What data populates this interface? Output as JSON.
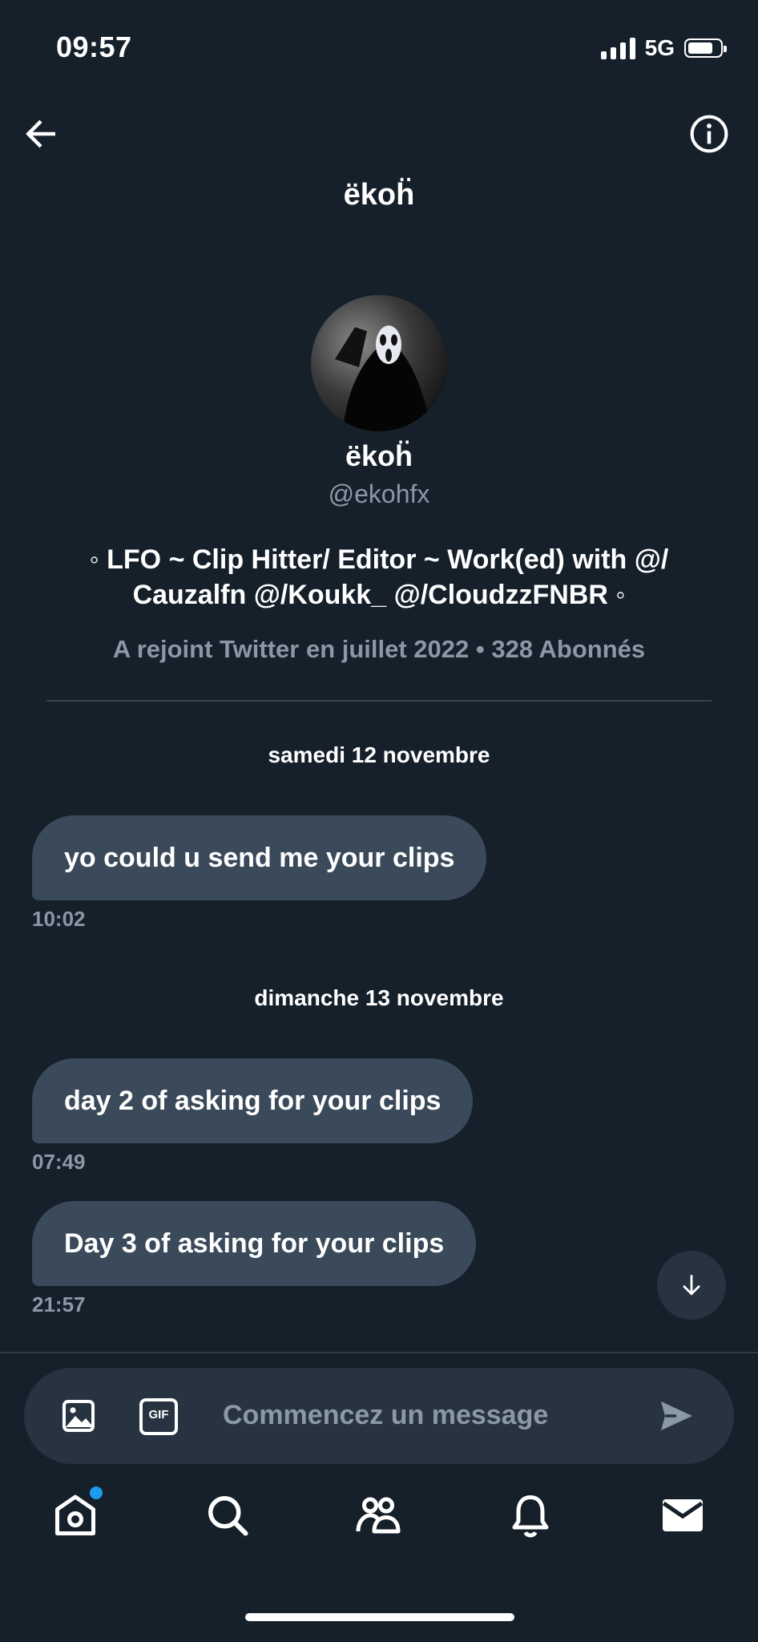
{
  "status_bar": {
    "time": "09:57",
    "network": "5G"
  },
  "header": {
    "title": "ëkoḧ"
  },
  "profile": {
    "name": "ëkoḧ",
    "handle": "@ekohfx",
    "bio_line1": "◦  LFO ~ Clip Hitter/ Editor ~ Work(ed) with @/",
    "bio_line2": "Cauzalfn @/Koukk_ @/CloudzzFNBR  ◦",
    "meta": "A rejoint Twitter en juillet 2022 • 328 Abonnés"
  },
  "conversation": {
    "groups": [
      {
        "date": "samedi 12 novembre",
        "messages": [
          {
            "text": "yo could u send me your clips",
            "time": "10:02"
          }
        ]
      },
      {
        "date": "dimanche 13 novembre",
        "messages": [
          {
            "text": "day 2 of asking for your clips",
            "time": "07:49"
          },
          {
            "text": "Day 3 of asking for your clips",
            "time": "21:57"
          }
        ]
      }
    ]
  },
  "composer": {
    "placeholder": "Commencez un message",
    "gif_label": "GIF"
  },
  "colors": {
    "background": "#15202b",
    "bubble": "#3b4a5a",
    "muted_text": "#8b98a5",
    "accent": "#1d9bf0"
  },
  "icons": [
    "back-arrow-icon",
    "info-icon",
    "image-icon",
    "gif-icon",
    "send-icon",
    "arrow-down-icon",
    "home-icon",
    "search-icon",
    "communities-icon",
    "bell-icon",
    "mail-icon"
  ]
}
